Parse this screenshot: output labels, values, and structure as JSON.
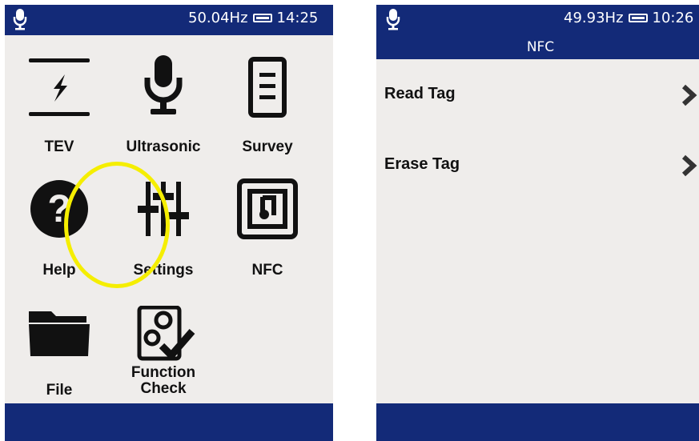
{
  "colors": {
    "bar": "#132a78",
    "screen_bg": "#efedeb",
    "highlight": "#f5ee00",
    "icon": "#111111"
  },
  "left_screen": {
    "status": {
      "frequency": "50.04Hz",
      "time": "14:25",
      "icon": "microphone-icon"
    },
    "tiles": [
      {
        "id": "tev",
        "label": "TEV",
        "icon": "tev-lightning-icon"
      },
      {
        "id": "ultrasonic",
        "label": "Ultrasonic",
        "icon": "microphone-icon"
      },
      {
        "id": "survey",
        "label": "Survey",
        "icon": "document-icon"
      },
      {
        "id": "help",
        "label": "Help",
        "icon": "help-question-icon"
      },
      {
        "id": "settings",
        "label": "Settings",
        "icon": "sliders-icon"
      },
      {
        "id": "nfc",
        "label": "NFC",
        "icon": "nfc-icon"
      },
      {
        "id": "file",
        "label": "File",
        "icon": "folder-icon"
      },
      {
        "id": "function-check",
        "label_line1": "Function",
        "label_line2": "Check",
        "icon": "gears-check-icon"
      }
    ]
  },
  "right_screen": {
    "status": {
      "frequency": "49.93Hz",
      "time": "10:26",
      "icon": "microphone-icon"
    },
    "title": "NFC",
    "menu": [
      {
        "label": "Read Tag",
        "icon": "chevron-right-icon"
      },
      {
        "label": "Erase Tag",
        "icon": "chevron-right-icon"
      }
    ]
  }
}
